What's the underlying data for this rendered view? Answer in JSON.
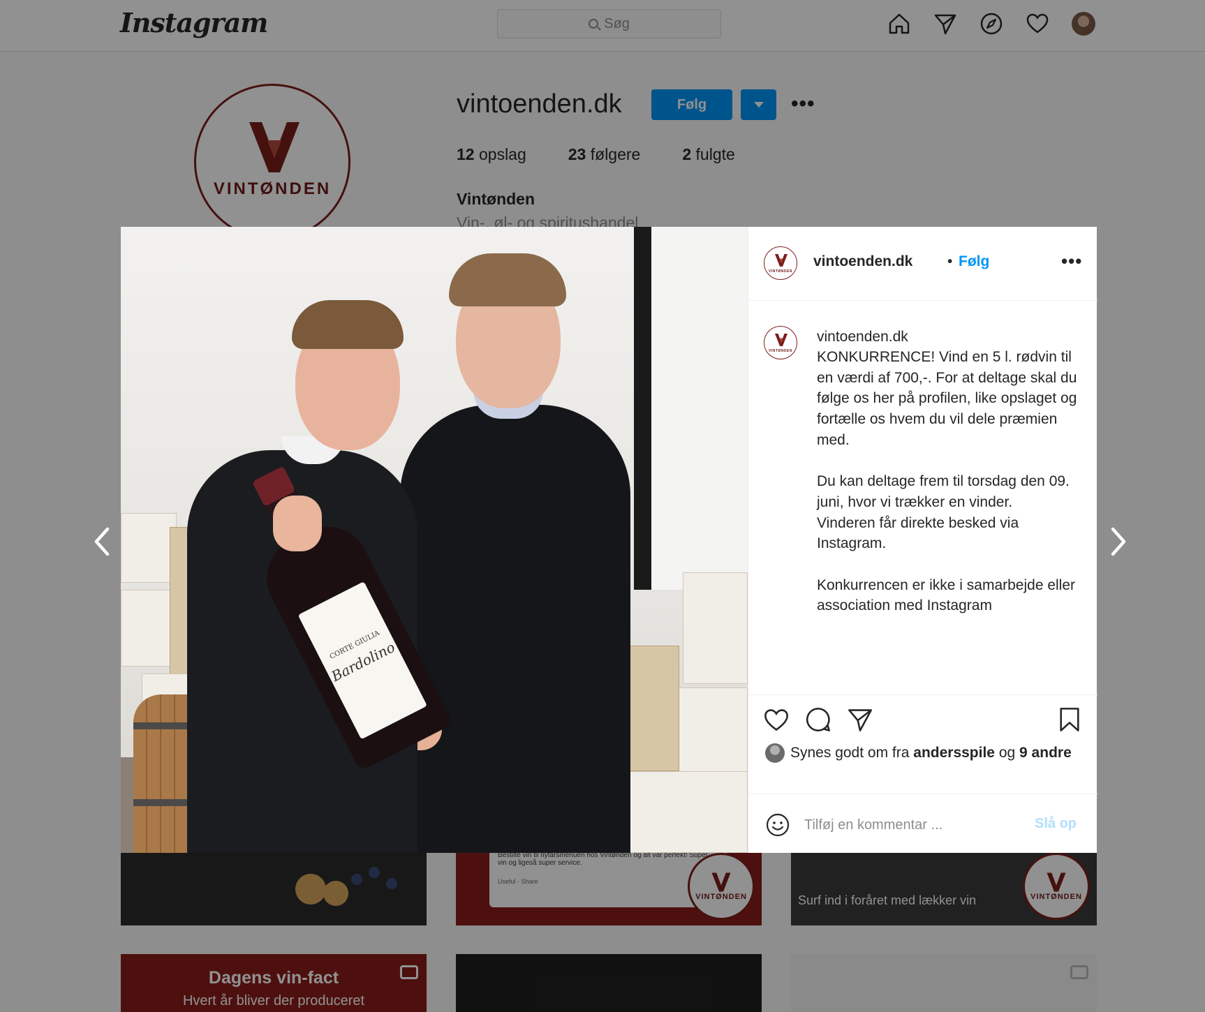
{
  "topbar": {
    "logo": "Instagram",
    "search_placeholder": "Søg",
    "icons": [
      "home-icon",
      "direct-icon",
      "explore-icon",
      "activity-heart-icon",
      "profile-avatar"
    ]
  },
  "profile": {
    "username": "vintoenden.dk",
    "follow_label": "Følg",
    "stats": {
      "posts_count": "12",
      "posts_label": "opslag",
      "followers_count": "23",
      "followers_label": "følgere",
      "following_count": "2",
      "following_label": "fulgte"
    },
    "name": "Vintønden",
    "category": "Vin-, øl- og spiritushandel",
    "logo_text": "VINTØNDEN",
    "brand_color": "#7a1f1b"
  },
  "grid": {
    "review_text": "Bestilte vin til nytårsmenuen hos Vintønden og alt var perfekt! Super vin og ligeså super service.",
    "review_useful": "Useful",
    "review_share": "Share",
    "badge_text": "VINTØNDEN",
    "spring_text": "Surf ind i foråret med lækker vin",
    "vinfact_title": "Dagens vin-fact",
    "vinfact_sub": "Hvert år bliver der produceret"
  },
  "post": {
    "username": "vintoenden.dk",
    "separator": "•",
    "follow_label": "Følg",
    "caption_user": "vintoenden.dk",
    "caption": "KONKURRENCE! Vind en 5 l. rødvin til en værdi af 700,-. For at deltage skal du følge os her på profilen, like opslaget og fortælle os hvem du vil dele præmien med.\n\nDu kan deltage frem til torsdag den 09. juni, hvor vi trækker en vinder.\nVinderen får direkte besked via Instagram.\n\nKonkurrencen er ikke i samarbejde eller association med Instagram",
    "likes_prefix": "Synes godt om fra",
    "likes_user": "andersspile",
    "likes_and": "og",
    "likes_others": "9 andre",
    "comment_placeholder": "Tilføj en kommentar ...",
    "post_label": "Slå op",
    "accent_color": "#0095f6"
  },
  "photo": {
    "label_title": "CORTE GIULIA",
    "label_script": "Bardolino"
  }
}
